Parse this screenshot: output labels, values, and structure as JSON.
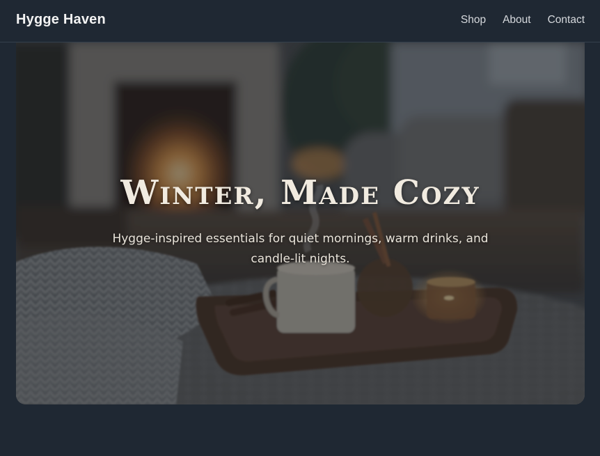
{
  "header": {
    "brand": "Hygge Haven",
    "nav": [
      {
        "label": "Shop"
      },
      {
        "label": "About"
      },
      {
        "label": "Contact"
      }
    ]
  },
  "hero": {
    "title": "Winter, Made Cozy",
    "subtitle": "Hygge-inspired essentials for quiet mornings, warm drinks, and candle-lit nights.",
    "image_description_icon": "cozy-living-room-photo"
  },
  "colors": {
    "page_background": "#1f2833",
    "header_text": "#f3f3f3",
    "nav_text": "#d6d9dd",
    "hero_title": "#f1ebe0",
    "hero_subtitle": "#e9e4da"
  }
}
